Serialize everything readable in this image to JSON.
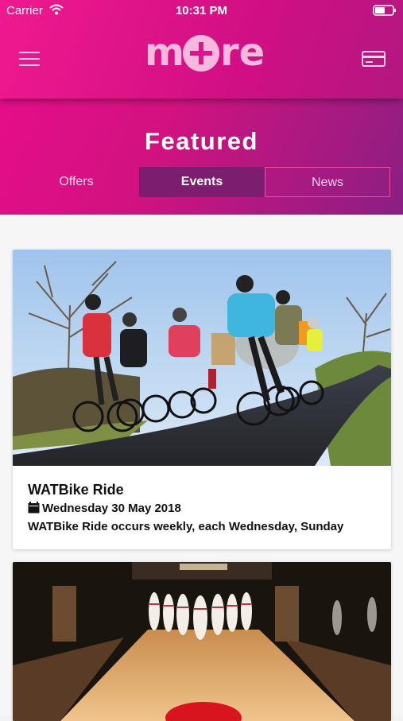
{
  "status": {
    "carrier": "Carrier",
    "time": "10:31 PM"
  },
  "header": {
    "menu_icon": "hamburger-menu-icon",
    "logo_text": "more",
    "card_icon": "credit-card-icon",
    "title": "Featured",
    "tabs": [
      {
        "label": "Offers",
        "active": false
      },
      {
        "label": "Events",
        "active": true
      },
      {
        "label": "News",
        "active": false
      }
    ]
  },
  "events": [
    {
      "title": "WATBike Ride",
      "date": "Wednesday 30 May 2018",
      "description": "WATBike Ride occurs weekly, each Wednesday, Sunday",
      "image": "cyclists-on-country-road"
    },
    {
      "image": "bowling-alley-pins"
    }
  ],
  "colors": {
    "brand_pink": "#e4158a",
    "active_tab": "#7c1d70",
    "tab_border": "#f04c9e"
  }
}
